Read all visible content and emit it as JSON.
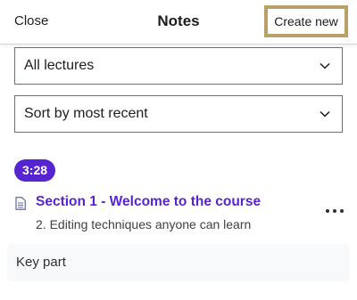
{
  "header": {
    "close_label": "Close",
    "title": "Notes",
    "create_label": "Create new"
  },
  "filters": {
    "lecture_filter": "All lectures",
    "sort": "Sort by most recent"
  },
  "note": {
    "timestamp": "3:28",
    "section_title": "Section 1 - Welcome to the course",
    "lecture_title": "2. Editing techniques anyone can learn",
    "body": "Key part"
  },
  "colors": {
    "accent": "#5624d0",
    "focus_outline": "#b8a067",
    "note_background": "#f7f9fa"
  },
  "icons": {
    "dropdown": "chevron-down-icon",
    "note": "document-icon",
    "more": "more-horizontal-icon"
  }
}
